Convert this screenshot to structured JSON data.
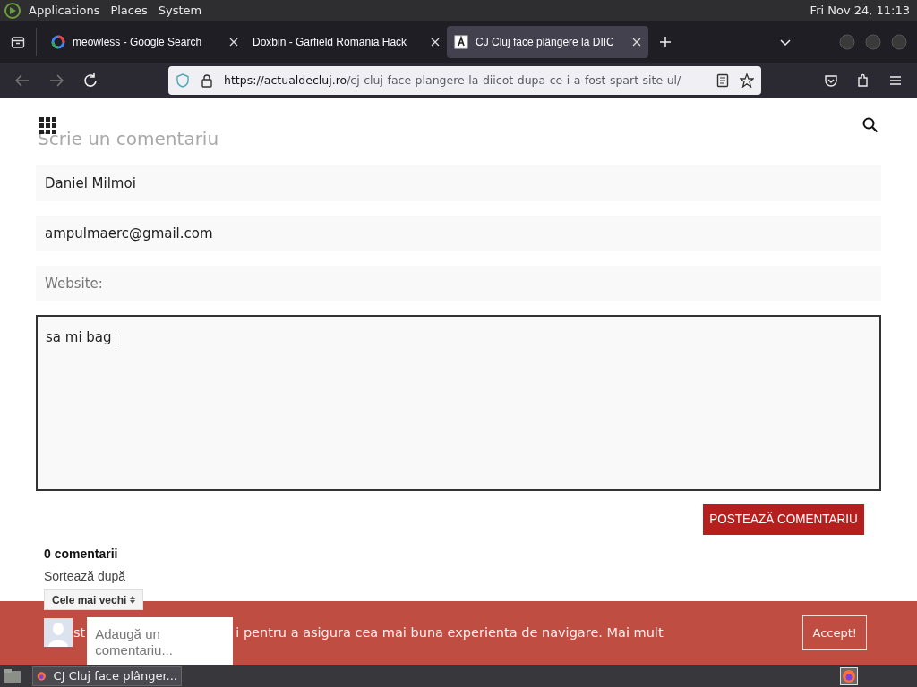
{
  "desktop_panel": {
    "menus": [
      "Applications",
      "Places",
      "System"
    ],
    "clock": "Fri Nov 24, 11:13"
  },
  "browser": {
    "tabs": [
      {
        "title": "meowless - Google Search",
        "selected": false
      },
      {
        "title": "Doxbin - Garfield Romania Hack",
        "selected": false
      },
      {
        "title": "CJ Cluj face plângere la DIIC",
        "selected": true
      }
    ],
    "url": {
      "domain": "https://actualdecluj.ro",
      "path": "/cj-cluj-face-plangere-la-diicot-dupa-ce-i-a-fost-spart-site-ul/"
    }
  },
  "page": {
    "faded_heading": "Scrie un comentariu",
    "fields": [
      {
        "value": "Daniel Milmoi"
      },
      {
        "value": "ampulmaerc@gmail.com"
      },
      {
        "placeholder": "Website:"
      }
    ],
    "message": "sa mi bag",
    "post_button": "POSTEAZĂ COMENTARIU",
    "comments_count": "0 comentarii",
    "sort_label": "Sortează după",
    "sort_select": "Cele mai vechi",
    "comment_box": {
      "placeholder": "Adaugă un comentariu..."
    },
    "cookie_banner": {
      "text_before": "st",
      "text_after": "i pentru a asigura cea mai buna experienta de navigare. Mai mult",
      "button": "Accept!"
    }
  },
  "taskbar": {
    "window_button": "CJ Cluj face plânger..."
  }
}
